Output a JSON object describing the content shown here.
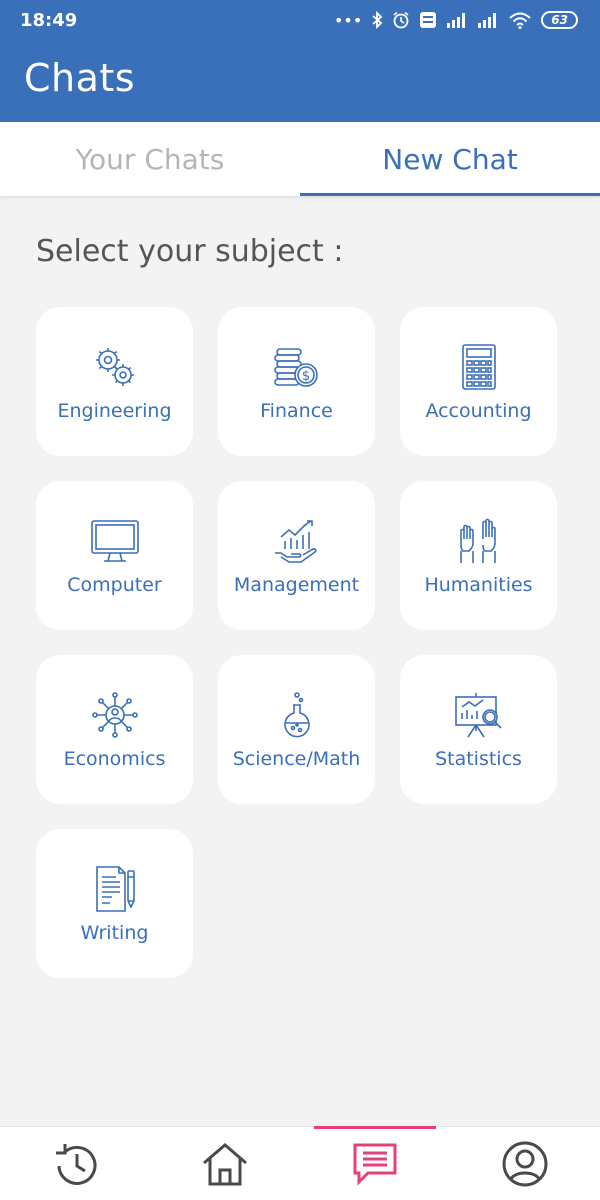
{
  "status_bar": {
    "time": "18:49",
    "battery": "63"
  },
  "header": {
    "title": "Chats"
  },
  "tabs": [
    {
      "label": "Your Chats",
      "active": false
    },
    {
      "label": "New Chat",
      "active": true
    }
  ],
  "section": {
    "title": "Select your subject :"
  },
  "subjects": [
    {
      "label": "Engineering",
      "icon": "gears-icon"
    },
    {
      "label": "Finance",
      "icon": "coins-icon"
    },
    {
      "label": "Accounting",
      "icon": "calculator-icon"
    },
    {
      "label": "Computer",
      "icon": "monitor-icon"
    },
    {
      "label": "Management",
      "icon": "growth-chart-hand-icon"
    },
    {
      "label": "Humanities",
      "icon": "raised-hands-icon"
    },
    {
      "label": "Economics",
      "icon": "network-person-icon"
    },
    {
      "label": "Science/Math",
      "icon": "flask-icon"
    },
    {
      "label": "Statistics",
      "icon": "presentation-board-icon"
    },
    {
      "label": "Writing",
      "icon": "document-pen-icon"
    }
  ],
  "bottom_nav": [
    {
      "name": "history-icon",
      "active": false
    },
    {
      "name": "home-icon",
      "active": false
    },
    {
      "name": "chat-icon",
      "active": true
    },
    {
      "name": "profile-icon",
      "active": false
    }
  ],
  "colors": {
    "primary": "#3a6fb9",
    "accent": "#e5407d",
    "background": "#f3f3f3"
  }
}
